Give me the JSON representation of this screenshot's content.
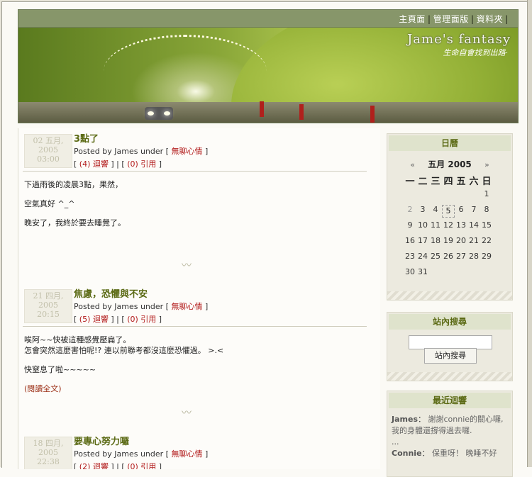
{
  "nav": {
    "links": [
      "主頁面",
      "管理面版",
      "資料夾"
    ]
  },
  "banner": {
    "title": "Jame's fantasy",
    "subtitle": "生命自會找到出路·"
  },
  "posts": [
    {
      "date_day": "02 五月,",
      "date_year": "2005",
      "date_time": "03:00",
      "title": "3點了",
      "posted_by": "Posted by James under [",
      "category": "無聊心情",
      "posted_end": "]",
      "comments_open": "[",
      "comments_count": "(4)",
      "comments_label": "迴響",
      "links_mid": "] | [",
      "trackback_count": "(0)",
      "trackback_label": "引用",
      "links_end": "]",
      "body": [
        "下過雨後的凌晨3點，果然，",
        "空氣真好 ^_^",
        "晚安了，我終於要去睡覺了。"
      ]
    },
    {
      "date_day": "21 四月,",
      "date_year": "2005",
      "date_time": "20:15",
      "title": "焦慮，恐懼與不安",
      "posted_by": "Posted by James under [",
      "category": "無聊心情",
      "posted_end": "]",
      "comments_open": "[",
      "comments_count": "(5)",
      "comments_label": "迴響",
      "links_mid": "] | [",
      "trackback_count": "(0)",
      "trackback_label": "引用",
      "links_end": "]",
      "body_line1": "唉阿~~快被這種感覺壓扁了。",
      "body_line2": "怎會突然這麼害怕呢!? 連以前聯考都沒這麼恐懼過。 >.<",
      "body_line3": "快窒息了啦~~~~~",
      "read_more": "(閱讀全文)"
    },
    {
      "date_day": "18 四月,",
      "date_year": "2005",
      "date_time": "22:38",
      "title": "要專心努力囉",
      "posted_by": "Posted by James under [",
      "category": "無聊心情",
      "posted_end": "]",
      "comments_open": "[",
      "comments_count": "(2)",
      "comments_label": "迴響",
      "links_mid": "] | [",
      "trackback_count": "(0)",
      "trackback_label": "引用",
      "links_end": "]"
    }
  ],
  "calendar": {
    "heading": "日曆",
    "prev": "«",
    "next": "»",
    "month_label": "五月 2005",
    "weekdays": [
      "一",
      "二",
      "三",
      "四",
      "五",
      "六",
      "日"
    ],
    "weeks": [
      [
        "",
        "",
        "",
        "",
        "",
        "",
        "1"
      ],
      [
        "2",
        "3",
        "4",
        "5",
        "6",
        "7",
        "8"
      ],
      [
        "9",
        "10",
        "11",
        "12",
        "13",
        "14",
        "15"
      ],
      [
        "16",
        "17",
        "18",
        "19",
        "20",
        "21",
        "22"
      ],
      [
        "23",
        "24",
        "25",
        "26",
        "27",
        "28",
        "29"
      ],
      [
        "30",
        "31",
        "",
        "",
        "",
        "",
        ""
      ]
    ],
    "today": "5",
    "muted_day": "2"
  },
  "search": {
    "heading": "站內搜尋",
    "button": "站內搜尋"
  },
  "recent": {
    "heading": "最近迴響",
    "items": [
      {
        "author": "James",
        "sep": "：",
        "text": "謝謝connie的關心囉, 我的身體還撐得過去囉."
      },
      {
        "author": "Connie",
        "sep": "：",
        "text": "保重呀！ 晚睡不好"
      }
    ],
    "ellipsis": "..."
  },
  "colors": {
    "accent": "#5b6a14",
    "nav_bg": "#87966a",
    "link_red": "#b21a1a"
  }
}
